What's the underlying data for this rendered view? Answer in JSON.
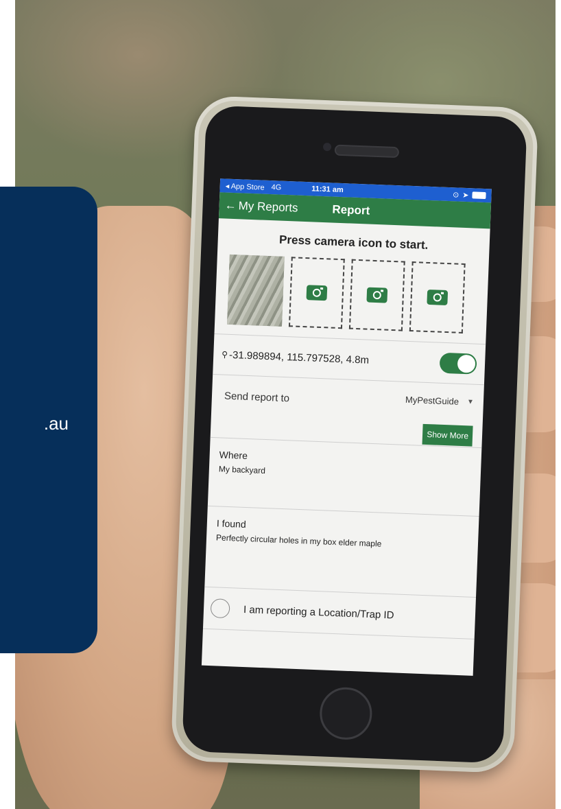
{
  "status_bar": {
    "carrier": "◂ App Store",
    "network": "4G",
    "time": "11:31 am"
  },
  "nav": {
    "back_label": "My Reports",
    "title": "Report"
  },
  "prompt": "Press camera icon to start.",
  "photos": {
    "slots": [
      "camera-icon",
      "camera-icon",
      "camera-icon"
    ]
  },
  "location": {
    "coordinates": "-31.989894, 115.797528, 4.8m",
    "toggle_on": true
  },
  "send_report": {
    "label": "Send report to",
    "selected": "MyPestGuide",
    "show_more_label": "Show More"
  },
  "where": {
    "label": "Where",
    "value": "My backyard"
  },
  "found": {
    "label": "I found",
    "value": "Perfectly circular holes in my box elder maple"
  },
  "trap_option": {
    "label": "I am reporting a Location/Trap ID"
  },
  "panel": {
    "text_fragment": ".au"
  },
  "colors": {
    "brand_green": "#2e7d46",
    "status_blue": "#1e5fd0",
    "panel_navy": "#062f5a"
  }
}
